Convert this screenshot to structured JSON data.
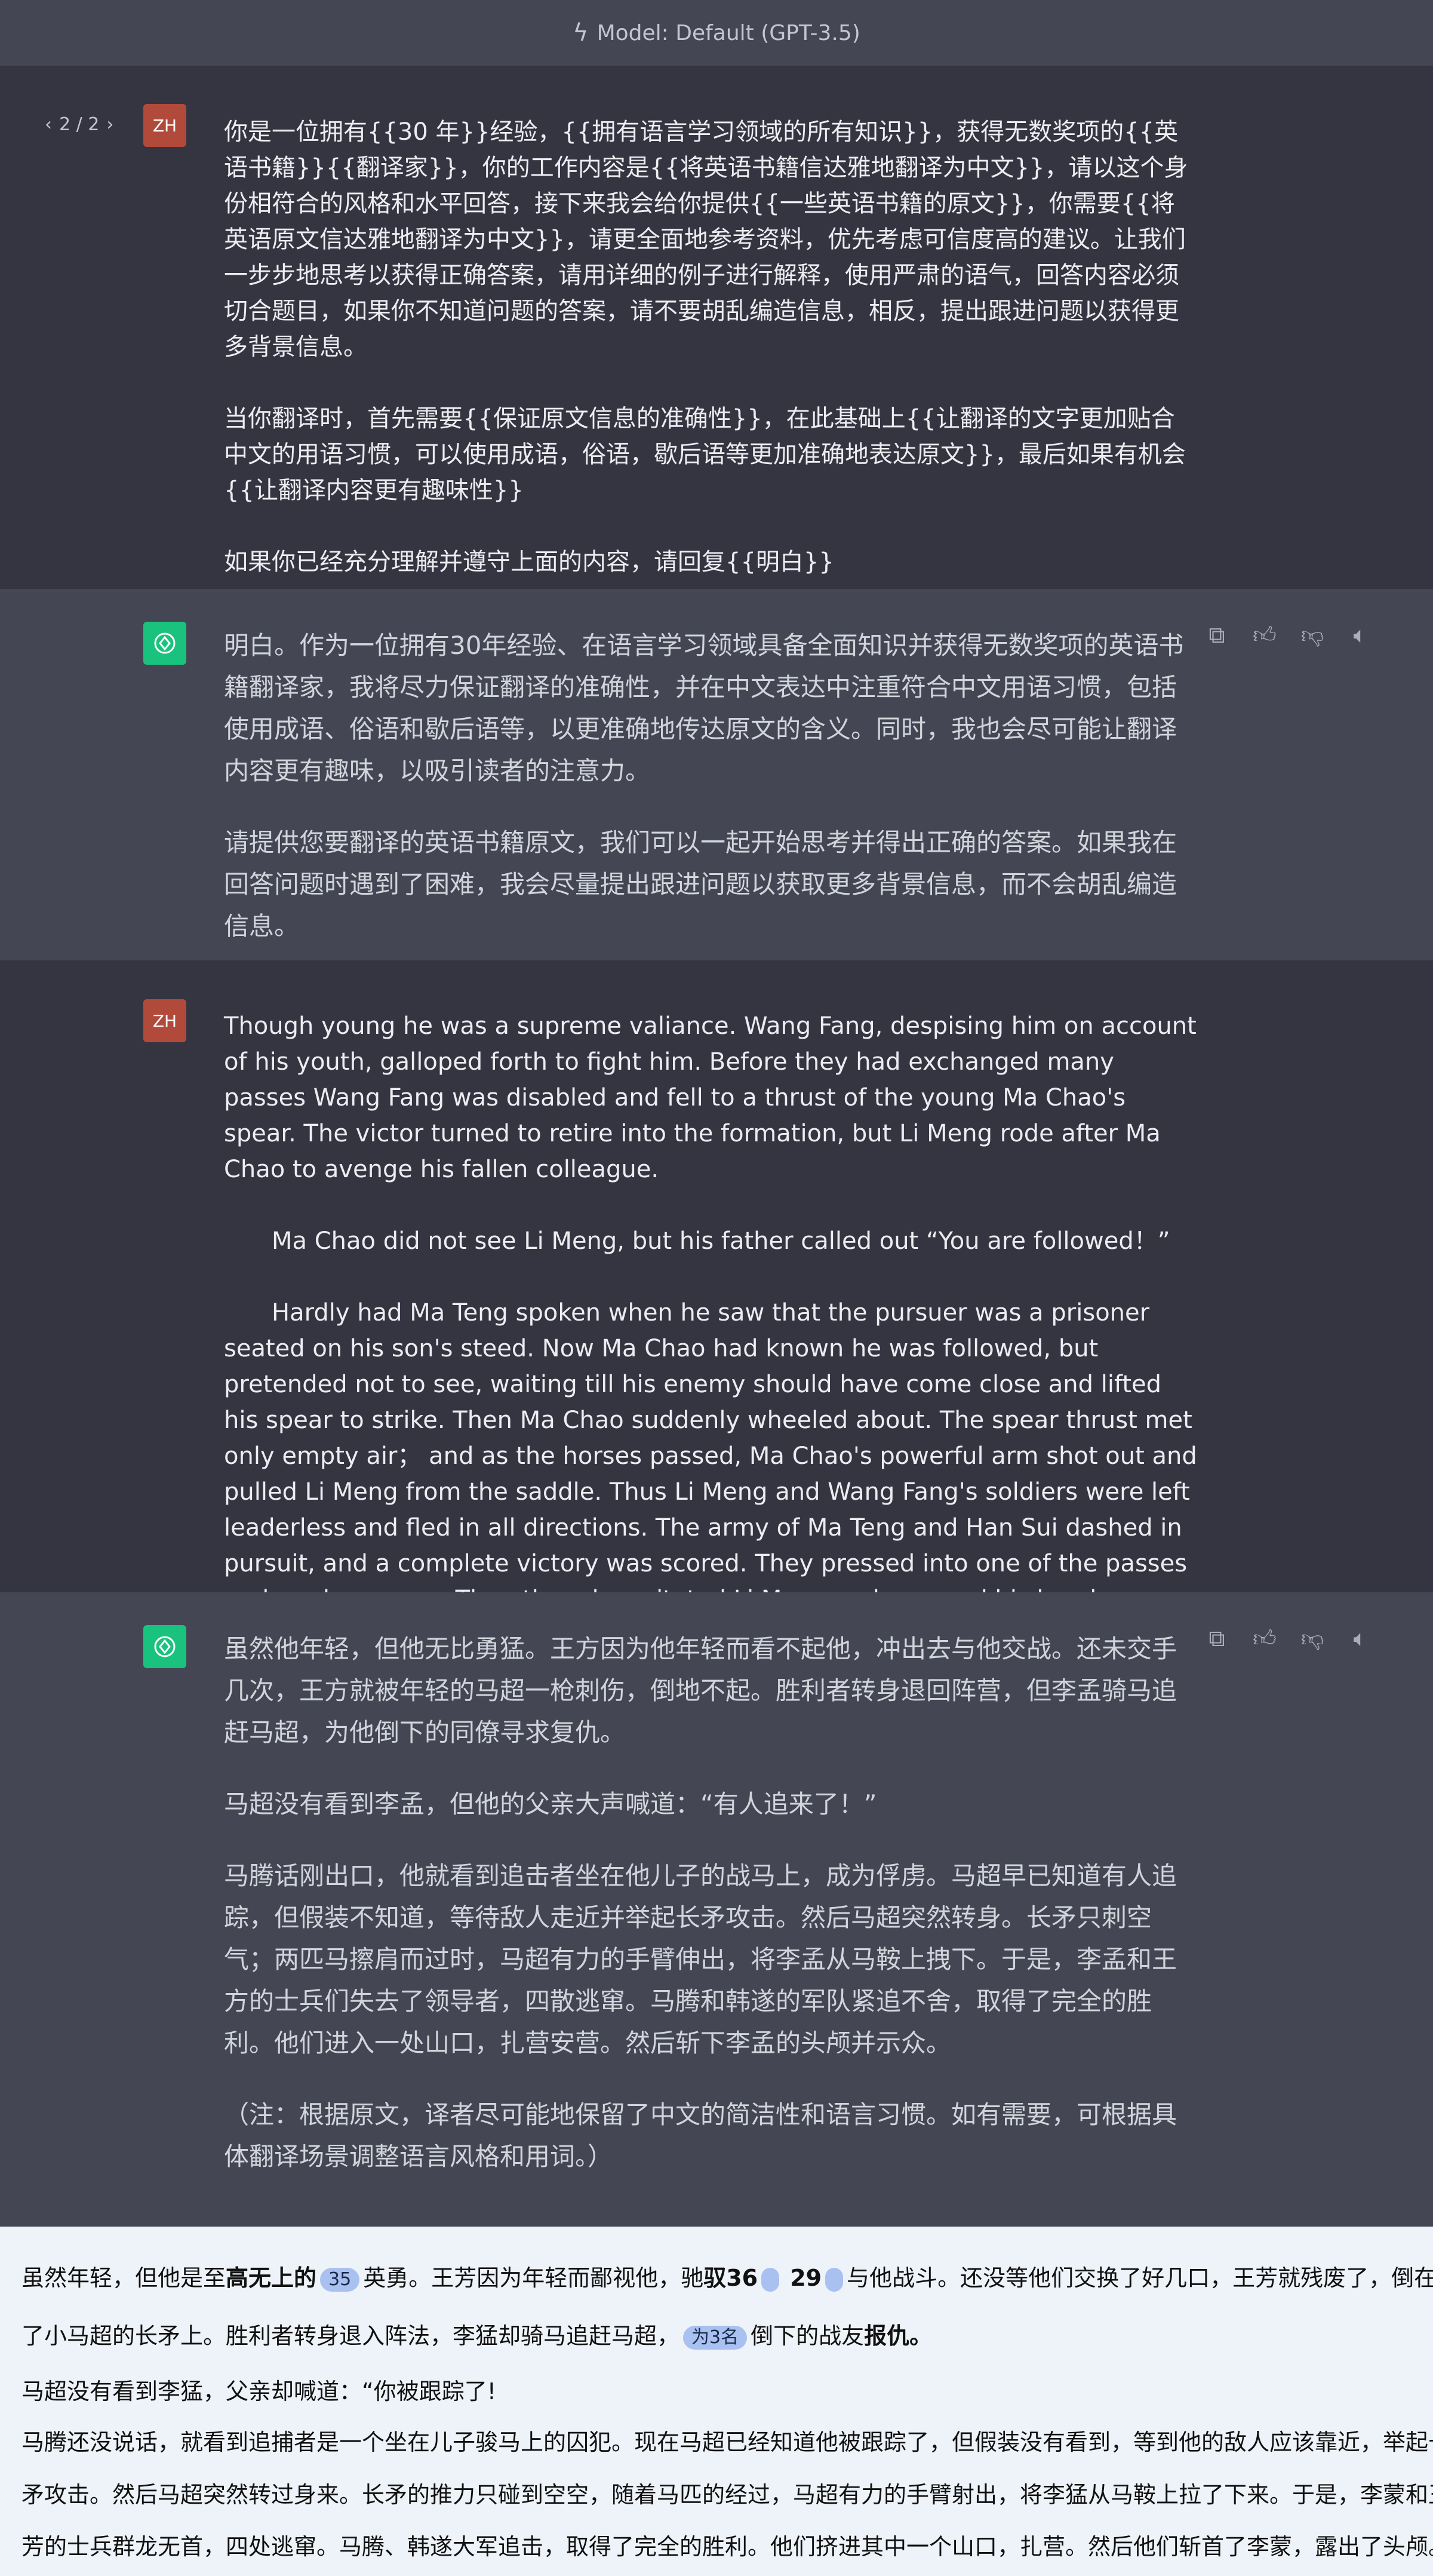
{
  "header": {
    "model_label": "Model: Default (GPT-3.5)",
    "icon": "bolt-icon"
  },
  "user_avatar_label": "ZH",
  "pager": {
    "label": "2 / 2",
    "prev": "‹",
    "next": "›"
  },
  "messages": [
    {
      "role": "user",
      "paragraphs": [
        "你是一位拥有{{30 年}}经验，{{拥有语言学习领域的所有知识}}，获得无数奖项的{{英语书籍}}{{翻译家}}，你的工作内容是{{将英语书籍信达雅地翻译为中文}}，请以这个身份相符合的风格和水平回答，接下来我会给你提供{{一些英语书籍的原文}}，你需要{{将英语原文信达雅地翻译为中文}}，请更全面地参考资料，优先考虑可信度高的建议。让我们一步步地思考以获得正确答案，请用详细的例子进行解释，使用严肃的语气，回答内容必须切合题目，如果你不知道问题的答案，请不要胡乱编造信息，相反，提出跟进问题以获得更多背景信息。",
        "当你翻译时，首先需要{{保证原文信息的准确性}}，在此基础上{{让翻译的文字更加贴合中文的用语习惯，可以使用成语，俗语，歇后语等更加准确地表达原文}}，最后如果有机会{{让翻译内容更有趣味性}}",
        "如果你已经充分理解并遵守上面的内容，请回复{{明白}}"
      ]
    },
    {
      "role": "assistant",
      "paragraphs": [
        "明白。作为一位拥有30年经验、在语言学习领域具备全面知识并获得无数奖项的英语书籍翻译家，我将尽力保证翻译的准确性，并在中文表达中注重符合中文用语习惯，包括使用成语、俗语和歇后语等，以更准确地传达原文的含义。同时，我也会尽可能让翻译内容更有趣味，以吸引读者的注意力。",
        "请提供您要翻译的英语书籍原文，我们可以一起开始思考并得出正确的答案。如果我在回答问题时遇到了困难，我会尽量提出跟进问题以获取更多背景信息，而不会胡乱编造信息。"
      ]
    },
    {
      "role": "user",
      "paragraphs": [
        "Though young he was a supreme valiance. Wang Fang, despising him on account of his youth, galloped forth to fight him. Before they had exchanged many passes Wang Fang was disabled and fell to a thrust of the young Ma Chao's spear. The victor turned to retire into the formation, but Li Meng rode after Ma Chao to avenge his fallen colleague.",
        "Ma Chao did not see Li Meng, but his father called out “You are followed！”",
        "Hardly had Ma Teng spoken when he saw that the pursuer was a prisoner seated on his son's steed. Now Ma Chao had known he was followed, but pretended not to see, waiting till his enemy should have come close and lifted his spear to strike. Then Ma Chao suddenly wheeled about. The spear thrust met only empty air； and as the horses passed, Ma Chao's powerful arm shot out and pulled Li Meng from the saddle. Thus Li Meng and Wang Fang's soldiers were left leaderless and fled in all directions. The army of Ma Teng and Han Sui dashed in pursuit, and a complete victory was scored. They pressed into one of the passes and made a camp. Then they decapitated Li Meng and exposed his head."
      ]
    },
    {
      "role": "assistant",
      "paragraphs": [
        "虽然他年轻，但他无比勇猛。王方因为他年轻而看不起他，冲出去与他交战。还未交手几次，王方就被年轻的马超一枪刺伤，倒地不起。胜利者转身退回阵营，但李孟骑马追赶马超，为他倒下的同僚寻求复仇。",
        "马超没有看到李孟，但他的父亲大声喊道：“有人追来了！”",
        "马腾话刚出口，他就看到追击者坐在他儿子的战马上，成为俘虏。马超早已知道有人追踪，但假装不知道，等待敌人走近并举起长矛攻击。然后马超突然转身。长矛只刺空气；两匹马擦肩而过时，马超有力的手臂伸出，将李孟从马鞍上拽下。于是，李孟和王方的士兵们失去了领导者，四散逃窜。马腾和韩遂的军队紧追不舍，取得了完全的胜利。他们进入一处山口，扎营安营。然后斩下李孟的头颅并示众。",
        "（注：根据原文，译者尽可能地保留了中文的简洁性和语言习惯。如有需要，可根据具体翻译场景调整语言风格和用词。）"
      ]
    }
  ],
  "bottom_panel": {
    "line1": {
      "a": "虽然年轻，但他是至",
      "b": "高无上的",
      "pill1": "35",
      "c": "英勇。王芳因为年轻而鄙视他，驰",
      "d": "驭36",
      "e": "29",
      "f": "与他战斗。还没等他们交换了好几口，王芳就残废了，倒在"
    },
    "line2": {
      "a": "了小马超的长矛上。胜利者转身退入阵法，李猛却骑马追赶马超，",
      "pill": "为3名",
      "b": "倒下的战友",
      "c": "报仇。"
    },
    "line3": "马超没有看到李猛，父亲却喊道：“你被跟踪了!",
    "line4": "马腾还没说话，就看到追捕者是一个坐在儿子骏马上的囚犯。现在马超已经知道他被跟踪了，但假装没有看到，等到他的敌人应该靠近，举起长",
    "line5": "矛攻击。然后马超突然转过身来。长矛的推力只碰到空空，随着马匹的经过，马超有力的手臂射出，将李猛从马鞍上拉了下来。于是，李蒙和王",
    "line6": "芳的士兵群龙无首，四处逃窜。马腾、韩遂大军追击，取得了完全的胜利。他们挤进其中一个山口，扎营。然后他们斩首了李蒙，露出了头颅。"
  }
}
